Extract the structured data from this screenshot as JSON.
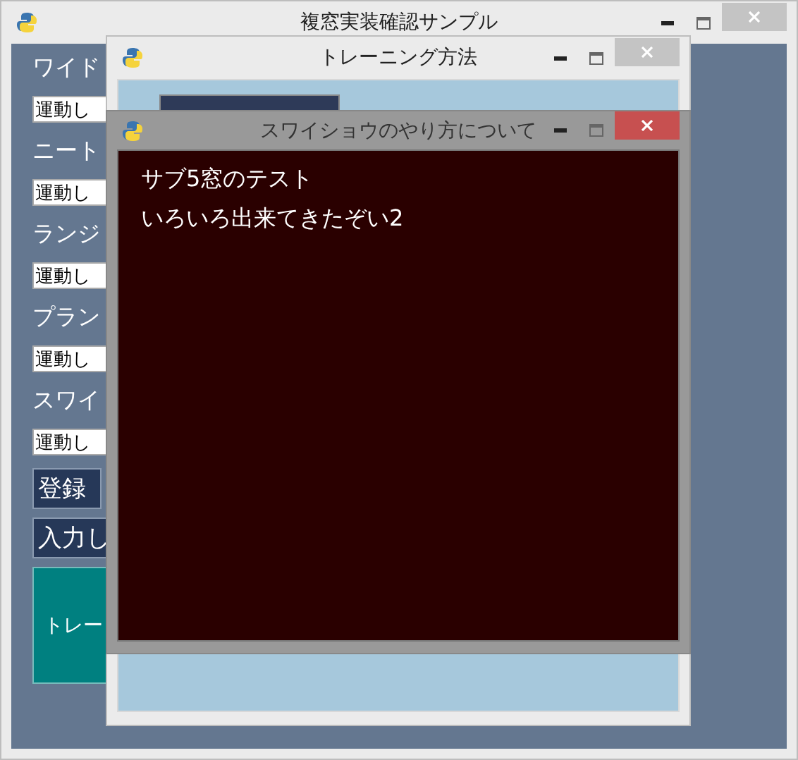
{
  "main_window": {
    "title": "複窓実装確認サンプル",
    "active": false,
    "fields": [
      {
        "label": "ワイド",
        "value": "運動し"
      },
      {
        "label": "ニート",
        "value": "運動し"
      },
      {
        "label": "ランジ",
        "value": "運動し"
      },
      {
        "label": "プラン",
        "value": "運動し"
      },
      {
        "label": "スワイ",
        "value": "運動し"
      }
    ],
    "buttons": [
      "登録",
      "入力し"
    ],
    "large_button": "トレー"
  },
  "training_window": {
    "title": "トレーニング方法",
    "active": false
  },
  "sub_window": {
    "title": "スワイショウのやり方について",
    "active": true,
    "lines": [
      "サブ5窓のテスト",
      "いろいろ出来てきたぞい2"
    ]
  }
}
